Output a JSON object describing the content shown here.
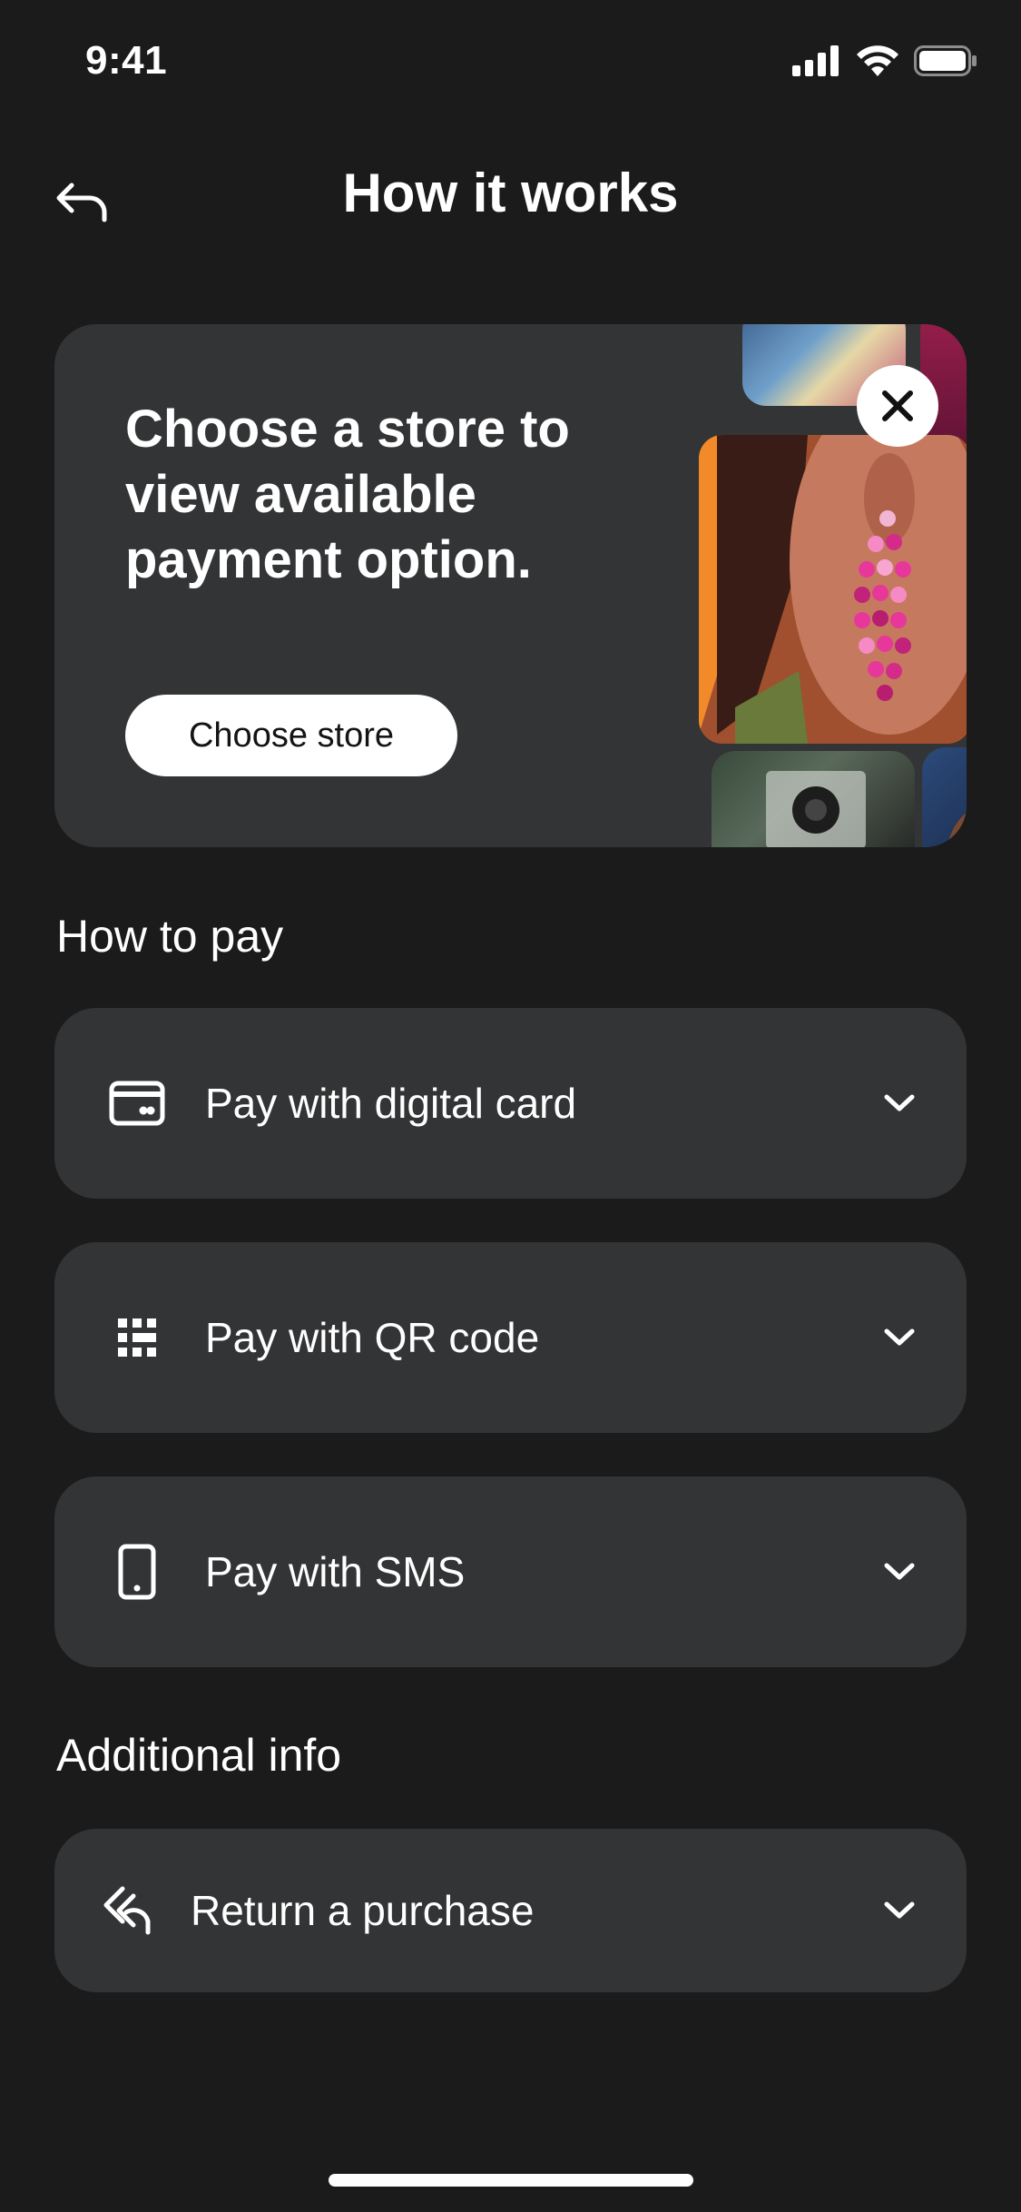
{
  "status_bar": {
    "time": "9:41"
  },
  "header": {
    "title": "How it works"
  },
  "promo": {
    "text": "Choose a store to view available payment option.",
    "button_label": "Choose store"
  },
  "how_to_pay": {
    "title": "How to pay",
    "items": [
      {
        "label": "Pay with digital card",
        "icon": "credit-card-icon"
      },
      {
        "label": "Pay with QR code",
        "icon": "qr-code-icon"
      },
      {
        "label": "Pay with SMS",
        "icon": "smartphone-icon"
      }
    ]
  },
  "additional_info": {
    "title": "Additional info",
    "items": [
      {
        "label": "Return a purchase",
        "icon": "return-icon"
      }
    ]
  },
  "colors": {
    "background": "#1b1b1b",
    "card": "#333435",
    "text": "#ffffff",
    "button_bg": "#ffffff",
    "button_text": "#141414"
  }
}
